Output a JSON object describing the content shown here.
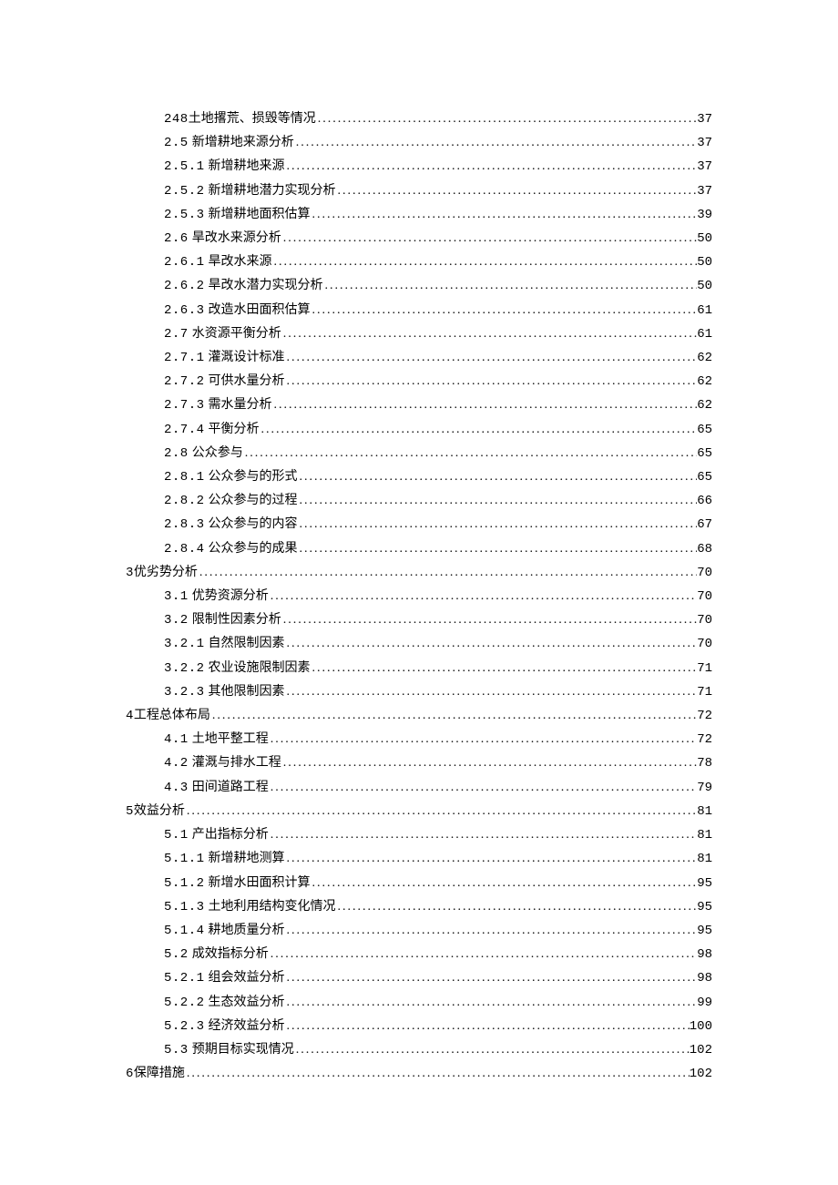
{
  "toc": [
    {
      "level": 1,
      "num": "248",
      "label": "土地撂荒、损毁等情况",
      "page": "37",
      "nopad": true
    },
    {
      "level": 1,
      "num": "2.5",
      "label": "新增耕地来源分析",
      "page": "37"
    },
    {
      "level": 2,
      "num": "2.5.1",
      "label": "新增耕地来源",
      "page": "37"
    },
    {
      "level": 2,
      "num": "2.5.2",
      "label": "新增耕地潜力实现分析",
      "page": "37"
    },
    {
      "level": 2,
      "num": "2.5.3",
      "label": "新增耕地面积估算",
      "page": "39"
    },
    {
      "level": 1,
      "num": "2.6",
      "label": "旱改水来源分析",
      "page": "50"
    },
    {
      "level": 2,
      "num": "2.6.1",
      "label": "旱改水来源",
      "page": "50"
    },
    {
      "level": 2,
      "num": "2.6.2",
      "label": "旱改水潜力实现分析",
      "page": "50"
    },
    {
      "level": 2,
      "num": "2.6.3",
      "label": "改造水田面积估算",
      "page": "61"
    },
    {
      "level": 1,
      "num": "2.7",
      "label": "水资源平衡分析",
      "page": "61"
    },
    {
      "level": 2,
      "num": "2.7.1",
      "label": "灌溉设计标准",
      "page": "62"
    },
    {
      "level": 2,
      "num": "2.7.2",
      "label": "可供水量分析",
      "page": "62"
    },
    {
      "level": 2,
      "num": "2.7.3",
      "label": "需水量分析",
      "page": "62"
    },
    {
      "level": 2,
      "num": "2.7.4",
      "label": "平衡分析",
      "page": "65"
    },
    {
      "level": 1,
      "num": "2.8",
      "label": "公众参与",
      "page": "65"
    },
    {
      "level": 2,
      "num": "2.8.1",
      "label": "公众参与的形式",
      "page": "65"
    },
    {
      "level": 2,
      "num": "2.8.2",
      "label": "公众参与的过程",
      "page": "66"
    },
    {
      "level": 2,
      "num": "2.8.3",
      "label": "公众参与的内容",
      "page": "67"
    },
    {
      "level": 2,
      "num": "2.8.4",
      "label": "公众参与的成果",
      "page": "68"
    },
    {
      "level": 0,
      "num": "3",
      "label": "优劣势分析",
      "page": "70",
      "nopad": true
    },
    {
      "level": 1,
      "num": "3.1",
      "label": "优势资源分析",
      "page": "70"
    },
    {
      "level": 1,
      "num": "3.2",
      "label": "限制性因素分析",
      "page": "70"
    },
    {
      "level": 2,
      "num": "3.2.1",
      "label": "自然限制因素",
      "page": "70"
    },
    {
      "level": 2,
      "num": "3.2.2",
      "label": "农业设施限制因素",
      "page": "71"
    },
    {
      "level": 2,
      "num": "3.2.3",
      "label": "其他限制因素",
      "page": "71"
    },
    {
      "level": 0,
      "num": "4",
      "label": "工程总体布局",
      "page": "72",
      "nopad": true
    },
    {
      "level": 1,
      "num": "4.1",
      "label": "土地平整工程",
      "page": "72"
    },
    {
      "level": 1,
      "num": "4.2",
      "label": "灌溉与排水工程",
      "page": "78"
    },
    {
      "level": 1,
      "num": "4.3",
      "label": "田间道路工程",
      "page": "79"
    },
    {
      "level": 0,
      "num": "5",
      "label": "效益分析",
      "page": "81",
      "nopad": true
    },
    {
      "level": 1,
      "num": "5.1",
      "label": "产出指标分析",
      "page": "81"
    },
    {
      "level": 2,
      "num": "5.1.1",
      "label": "新增耕地测算",
      "page": "81"
    },
    {
      "level": 2,
      "num": "5.1.2",
      "label": "新增水田面积计算",
      "page": "95"
    },
    {
      "level": 2,
      "num": "5.1.3",
      "label": "土地利用结构变化情况",
      "page": "95"
    },
    {
      "level": 2,
      "num": "5.1.4",
      "label": "耕地质量分析",
      "page": "95"
    },
    {
      "level": 1,
      "num": "5.2",
      "label": "成效指标分析",
      "page": "98"
    },
    {
      "level": 2,
      "num": "5.2.1",
      "label": "组会效益分析",
      "page": "98"
    },
    {
      "level": 2,
      "num": "5.2.2",
      "label": "生态效益分析",
      "page": "99"
    },
    {
      "level": 2,
      "num": "5.2.3",
      "label": "经济效益分析",
      "page": "100"
    },
    {
      "level": 1,
      "num": "5.3",
      "label": "预期目标实现情况",
      "page": "102"
    },
    {
      "level": 0,
      "num": "6",
      "label": "保障措施",
      "page": "102",
      "nopad": true
    }
  ]
}
